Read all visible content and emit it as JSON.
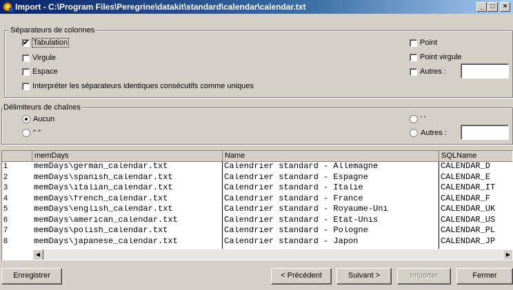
{
  "window": {
    "title": "Import - C:\\Program Files\\Peregrine\\datakit\\standard\\calendar\\calendar.txt"
  },
  "column_separators": {
    "legend": "Séparateurs de colonnes",
    "tab": {
      "label": "Tabulation",
      "checked": true
    },
    "comma": {
      "label": "Virgule",
      "checked": false
    },
    "space": {
      "label": "Espace",
      "checked": false
    },
    "consecutive": {
      "label": "Interpréter les séparateurs identiques consécutifs comme uniques",
      "checked": false
    },
    "point": {
      "label": "Point",
      "checked": false
    },
    "semicolon": {
      "label": "Point virgule",
      "checked": false
    },
    "other": {
      "label": "Autres :",
      "checked": false,
      "value": ""
    }
  },
  "string_delimiters": {
    "legend": "Délimiteurs de chaînes",
    "none": {
      "label": "Aucun",
      "selected": true
    },
    "double_quote": {
      "label": "\" \"",
      "selected": false
    },
    "single_quote": {
      "label": "' '",
      "selected": false
    },
    "other": {
      "label": "Autres :",
      "selected": false,
      "value": ""
    }
  },
  "table": {
    "headers": [
      "memDays",
      "Name",
      "SQLName"
    ],
    "rows": [
      {
        "num": "1",
        "memDays": "memDays\\german_calendar.txt",
        "name": "Calendrier standard - Allemagne",
        "sql": "CALENDAR_D"
      },
      {
        "num": "2",
        "memDays": "memDays\\spanish_calendar.txt",
        "name": "Calendrier standard - Espagne",
        "sql": "CALENDAR_E"
      },
      {
        "num": "3",
        "memDays": "memDays\\italian_calendar.txt",
        "name": "Calendrier standard - Italie",
        "sql": "CALENDAR_IT"
      },
      {
        "num": "4",
        "memDays": "memDays\\french_calendar.txt",
        "name": "Calendrier standard - France",
        "sql": "CALENDAR_F"
      },
      {
        "num": "5",
        "memDays": "memDays\\english_calendar.txt",
        "name": "Calendrier standard - Royaume-Uni",
        "sql": "CALENDAR_UK"
      },
      {
        "num": "6",
        "memDays": "memDays\\american_calendar.txt",
        "name": "Calendrier standard - Etat-Unis",
        "sql": "CALENDAR_US"
      },
      {
        "num": "7",
        "memDays": "memDays\\polish_calendar.txt",
        "name": "Calendrier standard - Pologne",
        "sql": "CALENDAR_PL"
      },
      {
        "num": "8",
        "memDays": "memDays\\japanese_calendar.txt",
        "name": "Calendrier standard - Japon",
        "sql": "CALENDAR_JP"
      }
    ]
  },
  "buttons": {
    "save": "Enregistrer",
    "previous": "< Précédent",
    "next": "Suivant >",
    "import": "Importer",
    "close": "Fermer"
  },
  "icons": {
    "app": "gear-icon",
    "minimize": "minimize-icon",
    "maximize": "maximize-icon",
    "close": "close-icon"
  }
}
